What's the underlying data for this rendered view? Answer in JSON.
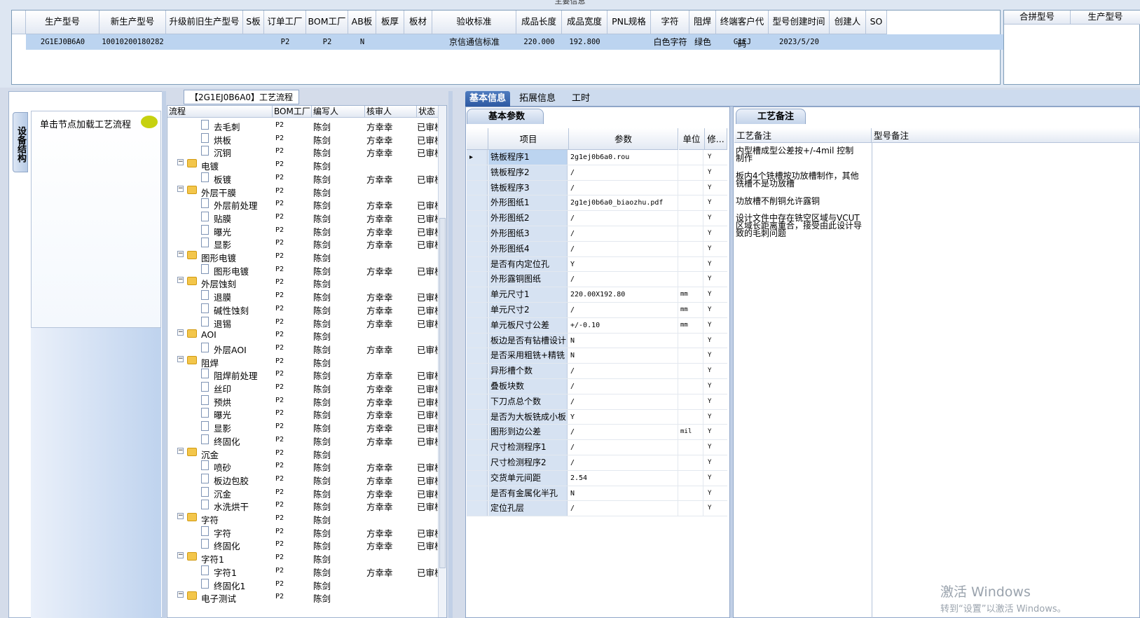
{
  "main_info": {
    "caption": "主要信息",
    "columns": [
      "生产型号",
      "新生产型号",
      "升级前旧生产型号",
      "S板",
      "订单工厂",
      "BOM工厂",
      "AB板",
      "板厚",
      "板材",
      "验收标准",
      "成品长度",
      "成品宽度",
      "PNL规格",
      "字符",
      "阻焊",
      "终端客户代码",
      "型号创建时间",
      "创建人",
      "SO"
    ],
    "row": [
      "2G1EJ0B6A0",
      "10010200180282",
      "",
      "",
      "P2",
      "P2",
      "N",
      "",
      "",
      "京信通信标准",
      "220.000",
      "192.800",
      "",
      "白色字符",
      "绿色",
      "G1EJ",
      "2023/5/20",
      "",
      ""
    ],
    "merge_columns": [
      "合拼型号",
      "生产型号"
    ]
  },
  "left_panel": {
    "vertical_tab": "设备结构",
    "tip": "单击节点加载工艺流程"
  },
  "tree": {
    "title": "【2G1EJ0B6A0】工艺流程",
    "columns": [
      "流程",
      "BOM工厂",
      "编写人",
      "核审人",
      "状态"
    ],
    "rows": [
      {
        "name": "去毛刺",
        "level": 2,
        "bom": "P2",
        "writer": "陈剑",
        "reviewer": "方幸幸",
        "status": "已审核"
      },
      {
        "name": "烘板",
        "level": 2,
        "bom": "P2",
        "writer": "陈剑",
        "reviewer": "方幸幸",
        "status": "已审核"
      },
      {
        "name": "沉铜",
        "level": 2,
        "bom": "P2",
        "writer": "陈剑",
        "reviewer": "方幸幸",
        "status": "已审核"
      },
      {
        "name": "电镀",
        "level": 1,
        "bom": "P2",
        "writer": "陈剑",
        "reviewer": "",
        "status": ""
      },
      {
        "name": "板镀",
        "level": 2,
        "bom": "P2",
        "writer": "陈剑",
        "reviewer": "方幸幸",
        "status": "已审核"
      },
      {
        "name": "外层干膜",
        "level": 1,
        "bom": "P2",
        "writer": "陈剑",
        "reviewer": "",
        "status": ""
      },
      {
        "name": "外层前处理",
        "level": 2,
        "bom": "P2",
        "writer": "陈剑",
        "reviewer": "方幸幸",
        "status": "已审核"
      },
      {
        "name": "贴膜",
        "level": 2,
        "bom": "P2",
        "writer": "陈剑",
        "reviewer": "方幸幸",
        "status": "已审核"
      },
      {
        "name": "曝光",
        "level": 2,
        "bom": "P2",
        "writer": "陈剑",
        "reviewer": "方幸幸",
        "status": "已审核"
      },
      {
        "name": "显影",
        "level": 2,
        "bom": "P2",
        "writer": "陈剑",
        "reviewer": "方幸幸",
        "status": "已审核"
      },
      {
        "name": "图形电镀",
        "level": 1,
        "bom": "P2",
        "writer": "陈剑",
        "reviewer": "",
        "status": ""
      },
      {
        "name": "图形电镀",
        "level": 2,
        "bom": "P2",
        "writer": "陈剑",
        "reviewer": "方幸幸",
        "status": "已审核"
      },
      {
        "name": "外层蚀刻",
        "level": 1,
        "bom": "P2",
        "writer": "陈剑",
        "reviewer": "",
        "status": ""
      },
      {
        "name": "退膜",
        "level": 2,
        "bom": "P2",
        "writer": "陈剑",
        "reviewer": "方幸幸",
        "status": "已审核"
      },
      {
        "name": "碱性蚀刻",
        "level": 2,
        "bom": "P2",
        "writer": "陈剑",
        "reviewer": "方幸幸",
        "status": "已审核"
      },
      {
        "name": "退锡",
        "level": 2,
        "bom": "P2",
        "writer": "陈剑",
        "reviewer": "方幸幸",
        "status": "已审核"
      },
      {
        "name": "AOI",
        "level": 1,
        "bom": "P2",
        "writer": "陈剑",
        "reviewer": "",
        "status": ""
      },
      {
        "name": "外层AOI",
        "level": 2,
        "bom": "P2",
        "writer": "陈剑",
        "reviewer": "方幸幸",
        "status": "已审核"
      },
      {
        "name": "阻焊",
        "level": 1,
        "bom": "P2",
        "writer": "陈剑",
        "reviewer": "",
        "status": ""
      },
      {
        "name": "阻焊前处理",
        "level": 2,
        "bom": "P2",
        "writer": "陈剑",
        "reviewer": "方幸幸",
        "status": "已审核"
      },
      {
        "name": "丝印",
        "level": 2,
        "bom": "P2",
        "writer": "陈剑",
        "reviewer": "方幸幸",
        "status": "已审核"
      },
      {
        "name": "预烘",
        "level": 2,
        "bom": "P2",
        "writer": "陈剑",
        "reviewer": "方幸幸",
        "status": "已审核"
      },
      {
        "name": "曝光",
        "level": 2,
        "bom": "P2",
        "writer": "陈剑",
        "reviewer": "方幸幸",
        "status": "已审核"
      },
      {
        "name": "显影",
        "level": 2,
        "bom": "P2",
        "writer": "陈剑",
        "reviewer": "方幸幸",
        "status": "已审核"
      },
      {
        "name": "终固化",
        "level": 2,
        "bom": "P2",
        "writer": "陈剑",
        "reviewer": "方幸幸",
        "status": "已审核"
      },
      {
        "name": "沉金",
        "level": 1,
        "bom": "P2",
        "writer": "陈剑",
        "reviewer": "",
        "status": ""
      },
      {
        "name": "喷砂",
        "level": 2,
        "bom": "P2",
        "writer": "陈剑",
        "reviewer": "方幸幸",
        "status": "已审核"
      },
      {
        "name": "板边包胶",
        "level": 2,
        "bom": "P2",
        "writer": "陈剑",
        "reviewer": "方幸幸",
        "status": "已审核"
      },
      {
        "name": "沉金",
        "level": 2,
        "bom": "P2",
        "writer": "陈剑",
        "reviewer": "方幸幸",
        "status": "已审核"
      },
      {
        "name": "水洗烘干",
        "level": 2,
        "bom": "P2",
        "writer": "陈剑",
        "reviewer": "方幸幸",
        "status": "已审核"
      },
      {
        "name": "字符",
        "level": 1,
        "bom": "P2",
        "writer": "陈剑",
        "reviewer": "",
        "status": ""
      },
      {
        "name": "字符",
        "level": 2,
        "bom": "P2",
        "writer": "陈剑",
        "reviewer": "方幸幸",
        "status": "已审核"
      },
      {
        "name": "终固化",
        "level": 2,
        "bom": "P2",
        "writer": "陈剑",
        "reviewer": "方幸幸",
        "status": "已审核"
      },
      {
        "name": "字符1",
        "level": 1,
        "bom": "P2",
        "writer": "陈剑",
        "reviewer": "",
        "status": ""
      },
      {
        "name": "字符1",
        "level": 2,
        "bom": "P2",
        "writer": "陈剑",
        "reviewer": "方幸幸",
        "status": "已审核"
      },
      {
        "name": "终固化1",
        "level": 2,
        "bom": "P2",
        "writer": "陈剑",
        "reviewer": "",
        "status": ""
      },
      {
        "name": "电子测试",
        "level": 1,
        "bom": "P2",
        "writer": "陈剑",
        "reviewer": "",
        "status": ""
      }
    ]
  },
  "tabs": [
    "基本信息",
    "拓展信息",
    "工时"
  ],
  "basic_params": {
    "title": "基本参数",
    "columns": [
      "项目",
      "参数",
      "单位",
      "修..."
    ],
    "rows": [
      {
        "item": "铣板程序1",
        "param": "2g1ej0b6a0.rou",
        "unit": "",
        "mod": "Y"
      },
      {
        "item": "铣板程序2",
        "param": "/",
        "unit": "",
        "mod": "Y"
      },
      {
        "item": "铣板程序3",
        "param": "/",
        "unit": "",
        "mod": "Y"
      },
      {
        "item": "外形图纸1",
        "param": "2g1ej0b6a0_biaozhu.pdf",
        "unit": "",
        "mod": "Y"
      },
      {
        "item": "外形图纸2",
        "param": "/",
        "unit": "",
        "mod": "Y"
      },
      {
        "item": "外形图纸3",
        "param": "/",
        "unit": "",
        "mod": "Y"
      },
      {
        "item": "外形图纸4",
        "param": "/",
        "unit": "",
        "mod": "Y"
      },
      {
        "item": "是否有内定位孔",
        "param": "Y",
        "unit": "",
        "mod": "Y"
      },
      {
        "item": "外形露铜图纸",
        "param": "/",
        "unit": "",
        "mod": "Y"
      },
      {
        "item": "单元尺寸1",
        "param": "220.00X192.80",
        "unit": "mm",
        "mod": "Y"
      },
      {
        "item": "单元尺寸2",
        "param": "/",
        "unit": "mm",
        "mod": "Y"
      },
      {
        "item": "单元板尺寸公差",
        "param": "+/-0.10",
        "unit": "mm",
        "mod": "Y"
      },
      {
        "item": "板边是否有钻槽设计",
        "param": "N",
        "unit": "",
        "mod": "Y"
      },
      {
        "item": "是否采用粗铣+精铣",
        "param": "N",
        "unit": "",
        "mod": "Y"
      },
      {
        "item": "异形槽个数",
        "param": "/",
        "unit": "",
        "mod": "Y"
      },
      {
        "item": "叠板块数",
        "param": "/",
        "unit": "",
        "mod": "Y"
      },
      {
        "item": "下刀点总个数",
        "param": "/",
        "unit": "",
        "mod": "Y"
      },
      {
        "item": "是否为大板铣成小板",
        "param": "Y",
        "unit": "",
        "mod": "Y"
      },
      {
        "item": "图形到边公差",
        "param": "/",
        "unit": "mil",
        "mod": "Y"
      },
      {
        "item": "尺寸检测程序1",
        "param": "/",
        "unit": "",
        "mod": "Y"
      },
      {
        "item": "尺寸检测程序2",
        "param": "/",
        "unit": "",
        "mod": "Y"
      },
      {
        "item": "交货单元间距",
        "param": "2.54",
        "unit": "",
        "mod": "Y"
      },
      {
        "item": "是否有金属化半孔",
        "param": "N",
        "unit": "",
        "mod": "Y"
      },
      {
        "item": "定位孔层",
        "param": "/",
        "unit": "",
        "mod": "Y"
      }
    ]
  },
  "remarks": {
    "title": "工艺备注",
    "columns": [
      "工艺备注",
      "型号备注"
    ],
    "notes": [
      "内型槽成型公差按+/-4mil 控制制作",
      "板内4个铣槽按功放槽制作，其他铣槽不是功放槽",
      "功放槽不削铜允许露铜",
      "设计文件中存在铣空区域与VCUT区域长距离重合，接受由此设计导致的毛刺问题"
    ]
  },
  "watermark": {
    "line1": "激活 Windows",
    "line2": "转到“设置”以激活 Windows。"
  }
}
